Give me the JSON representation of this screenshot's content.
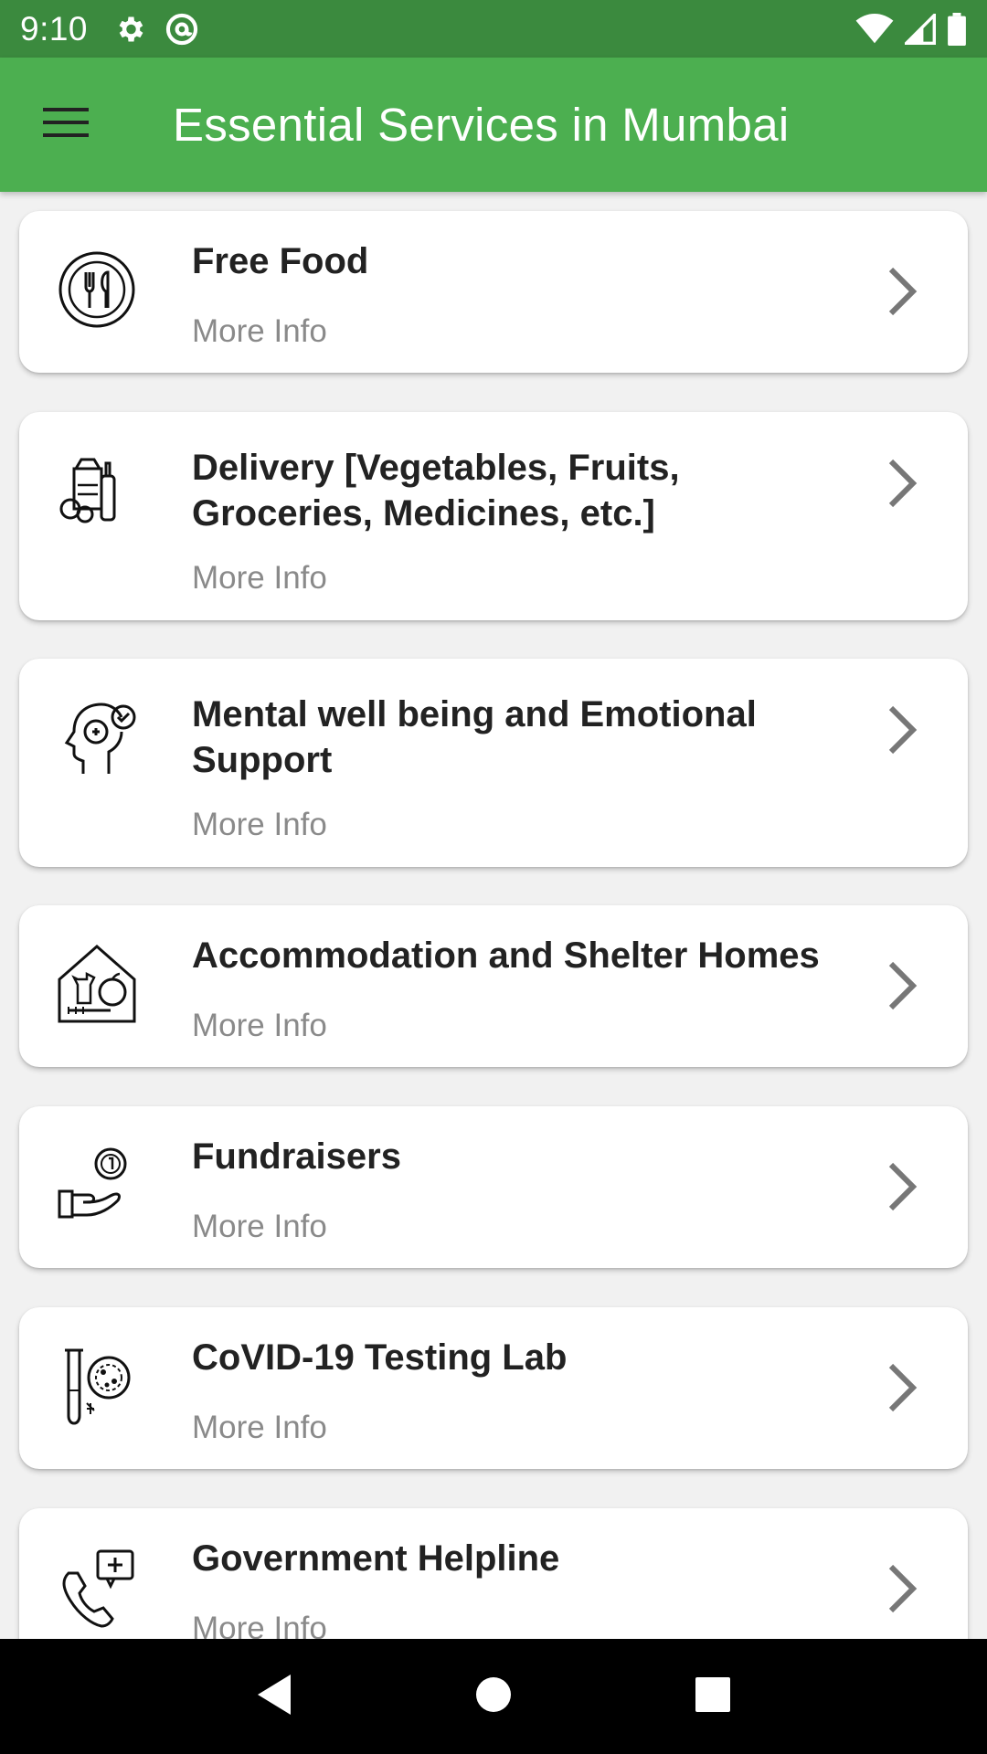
{
  "status_bar": {
    "time": "9:10",
    "left_icons": [
      "settings-gear-icon",
      "at-sign-icon"
    ],
    "right_icons": [
      "wifi-icon",
      "cell-signal-icon",
      "battery-icon"
    ]
  },
  "app_bar": {
    "title": "Essential Services in Mumbai",
    "menu_icon": "hamburger-menu-icon",
    "background": "#4caf50"
  },
  "services": [
    {
      "title": "Free Food",
      "subtitle": "More Info",
      "icon": "plate-cutlery-icon"
    },
    {
      "title": "Delivery [Vegetables, Fruits, Groceries, Medicines, etc.]",
      "subtitle": "More Info",
      "icon": "groceries-delivery-icon"
    },
    {
      "title": "Mental well being and Emotional Support",
      "subtitle": "More Info",
      "icon": "mental-health-head-icon"
    },
    {
      "title": "Accommodation and Shelter Homes",
      "subtitle": "More Info",
      "icon": "shelter-home-icon"
    },
    {
      "title": "Fundraisers",
      "subtitle": "More Info",
      "icon": "donation-hand-coin-icon"
    },
    {
      "title": "CoVID-19 Testing Lab",
      "subtitle": "More Info",
      "icon": "test-tube-virus-icon"
    },
    {
      "title": "Government Helpline",
      "subtitle": "More Info",
      "icon": "phone-medical-helpline-icon"
    }
  ],
  "nav_bar": {
    "icons": [
      "back-triangle-icon",
      "home-circle-icon",
      "recents-square-icon"
    ]
  }
}
